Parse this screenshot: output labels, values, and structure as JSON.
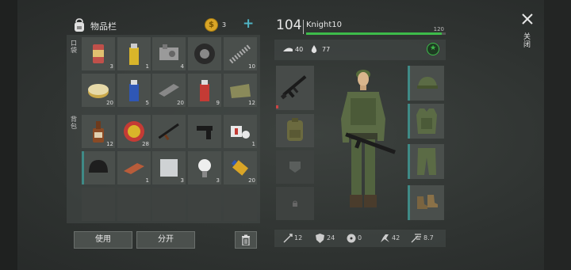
{
  "inventory": {
    "title": "物品栏",
    "currency_value": "3",
    "add_symbol": "+",
    "section_pocket": "口袋",
    "section_backpack": "背包",
    "rows": [
      [
        {
          "icon": "canned-food-icon",
          "count": "3"
        },
        {
          "icon": "yellow-spray-can-icon",
          "count": "1"
        },
        {
          "icon": "engine-parts-icon",
          "count": "4"
        },
        {
          "icon": "tire-icon",
          "count": ""
        },
        {
          "icon": "spring-icon",
          "count": "10"
        }
      ],
      [
        {
          "icon": "tuna-can-icon",
          "count": "20"
        },
        {
          "icon": "blue-spray-can-icon",
          "count": "5"
        },
        {
          "icon": "metal-bar-icon",
          "count": "20"
        },
        {
          "icon": "red-spray-can-icon",
          "count": "9"
        },
        {
          "icon": "cloth-icon",
          "count": "12"
        }
      ],
      [
        {
          "icon": "brown-bottle-icon",
          "count": "12"
        },
        {
          "icon": "bottle-cap-icon",
          "count": "28"
        },
        {
          "icon": "rifle-icon",
          "count": ""
        },
        {
          "icon": "pistol-icon",
          "count": ""
        },
        {
          "icon": "bandage-icon",
          "count": "1"
        }
      ],
      [
        {
          "icon": "helmet-icon",
          "count": ""
        },
        {
          "icon": "brick-icon",
          "count": "1"
        },
        {
          "icon": "metal-sheet-icon",
          "count": "3"
        },
        {
          "icon": "light-bulb-icon",
          "count": "3"
        },
        {
          "icon": "glue-tube-icon",
          "count": "20"
        }
      ]
    ],
    "use_button": "使用",
    "split_button": "分开"
  },
  "character": {
    "level": "104",
    "name": "Knight10",
    "xp_max": "120",
    "xp_fraction": 0.97,
    "food": "40",
    "water": "77"
  },
  "stats": [
    "12",
    "24",
    "0",
    "42",
    "8.7"
  ],
  "close_label": "关闭",
  "colors": {
    "accent": "#3f8a86",
    "xp_bar": "#3dbb4a",
    "currency": "#d9a527"
  }
}
